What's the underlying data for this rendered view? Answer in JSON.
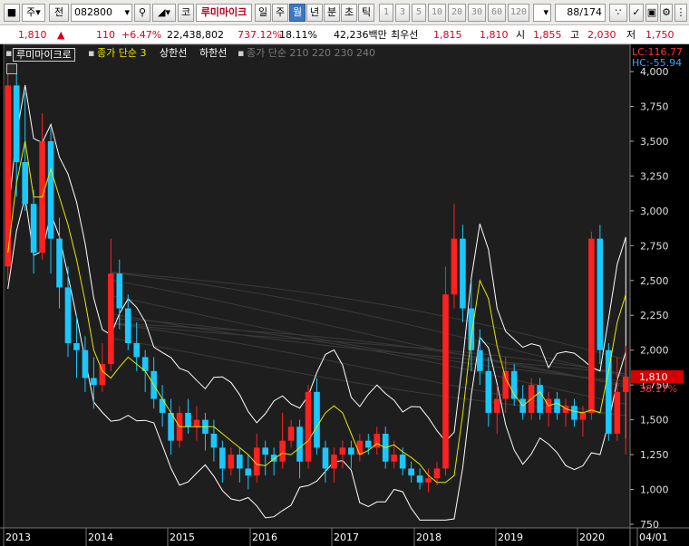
{
  "toolbar": {
    "market": "주",
    "market_mode": "전",
    "code": "082800",
    "stock_name": "루미마이크",
    "period_tabs": [
      "일",
      "주",
      "월",
      "년",
      "분",
      "초",
      "틱"
    ],
    "active_period": "월",
    "interval_buttons": [
      "1",
      "3",
      "5",
      "10",
      "20",
      "30",
      "60",
      "120"
    ],
    "page": "88",
    "page_total": "/174"
  },
  "info": {
    "price": "1,810",
    "change_arrow": "▲",
    "change": "110",
    "change_pct": "+6.47%",
    "volume": "22,438,802",
    "volume_ratio": "737.12%",
    "turnover": "18.11%",
    "amount": "42,236백만",
    "quote_label": "최우선",
    "ask": "1,815",
    "bid": "1,810",
    "open_label": "시",
    "open": "1,855",
    "high_label": "고",
    "high": "2,030",
    "low_label": "저",
    "low": "1,750"
  },
  "legend": {
    "name": "루미마이크로",
    "ma": "종가 단순 3",
    "upper": "상한선",
    "lower": "하한선",
    "long_ma": "종가 단순 210 220 230 240"
  },
  "readout": {
    "lc": "LC:116.77",
    "hc": "HC:-55.94",
    "last_price": "1,810",
    "last_pct": "38.17%"
  },
  "colors": {
    "up": "#ff2020",
    "down": "#19c8ff",
    "ma3": "#e8e800",
    "band": "#ffffff",
    "long_ma": "#3a3a3a",
    "price_tag": "#d60000"
  },
  "chart_data": {
    "type": "candlestick",
    "title": "루미마이크로",
    "ylim": [
      750,
      4000
    ],
    "y_ticks": [
      750,
      1000,
      1250,
      1500,
      1750,
      2000,
      2250,
      2500,
      2750,
      3000,
      3250,
      3500,
      3750,
      4000
    ],
    "y_tick_labels": [
      "750",
      "1,000",
      "1,250",
      "1,500",
      "1,750",
      "2,000",
      "2,250",
      "2,500",
      "2,750",
      "3,000",
      "3,250",
      "3,500",
      "3,750",
      "4,000"
    ],
    "x_labels": [
      "2013",
      "2014",
      "2015",
      "2016",
      "2017",
      "2018",
      "2019",
      "2020",
      "04/01"
    ],
    "candles": [
      [
        2600,
        4000,
        2500,
        3900
      ],
      [
        3900,
        4050,
        3100,
        3350
      ],
      [
        3350,
        3850,
        3000,
        3050
      ],
      [
        3050,
        3150,
        2550,
        2700
      ],
      [
        2700,
        3700,
        2650,
        3500
      ],
      [
        3500,
        3600,
        2550,
        2800
      ],
      [
        2800,
        2950,
        2300,
        2450
      ],
      [
        2450,
        2600,
        1950,
        2050
      ],
      [
        2050,
        2250,
        1800,
        2000
      ],
      [
        2000,
        2100,
        1700,
        1800
      ],
      [
        1800,
        1950,
        1580,
        1750
      ],
      [
        1750,
        2050,
        1700,
        1900
      ],
      [
        1900,
        2800,
        1850,
        2550
      ],
      [
        2550,
        2650,
        2150,
        2300
      ],
      [
        2300,
        2400,
        2000,
        2050
      ],
      [
        2050,
        2200,
        1850,
        1950
      ],
      [
        1950,
        2000,
        1700,
        1850
      ],
      [
        1850,
        1950,
        1580,
        1650
      ],
      [
        1650,
        1750,
        1450,
        1550
      ],
      [
        1550,
        1650,
        1250,
        1350
      ],
      [
        1350,
        1600,
        1300,
        1550
      ],
      [
        1550,
        1650,
        1400,
        1450
      ],
      [
        1450,
        1600,
        1350,
        1500
      ],
      [
        1500,
        1550,
        1280,
        1400
      ],
      [
        1400,
        1500,
        1200,
        1300
      ],
      [
        1300,
        1350,
        1050,
        1150
      ],
      [
        1150,
        1300,
        1100,
        1250
      ],
      [
        1250,
        1300,
        1050,
        1150
      ],
      [
        1150,
        1250,
        1000,
        1100
      ],
      [
        1100,
        1400,
        1050,
        1300
      ],
      [
        1300,
        1350,
        1100,
        1250
      ],
      [
        1250,
        1300,
        1100,
        1200
      ],
      [
        1200,
        1550,
        1150,
        1350
      ],
      [
        1350,
        1500,
        1300,
        1450
      ],
      [
        1450,
        1500,
        1080,
        1200
      ],
      [
        1200,
        1750,
        1150,
        1700
      ],
      [
        1700,
        1800,
        1250,
        1300
      ],
      [
        1300,
        1350,
        1050,
        1150
      ],
      [
        1150,
        1300,
        1050,
        1250
      ],
      [
        1250,
        1350,
        1150,
        1300
      ],
      [
        1300,
        1350,
        1150,
        1250
      ],
      [
        1250,
        1400,
        1200,
        1350
      ],
      [
        1350,
        1400,
        1250,
        1300
      ],
      [
        1300,
        1450,
        1250,
        1400
      ],
      [
        1400,
        1450,
        1150,
        1200
      ],
      [
        1200,
        1350,
        1150,
        1250
      ],
      [
        1250,
        1300,
        1100,
        1150
      ],
      [
        1150,
        1200,
        1050,
        1100
      ],
      [
        1100,
        1150,
        1000,
        1050
      ],
      [
        1050,
        1150,
        980,
        1080
      ],
      [
        1080,
        1200,
        1030,
        1150
      ],
      [
        1150,
        2600,
        1100,
        2400
      ],
      [
        2400,
        3050,
        2300,
        2800
      ],
      [
        2800,
        2900,
        2200,
        2300
      ],
      [
        2300,
        2500,
        1850,
        2000
      ],
      [
        2000,
        2150,
        1750,
        1850
      ],
      [
        1850,
        1950,
        1450,
        1550
      ],
      [
        1550,
        1750,
        1400,
        1650
      ],
      [
        1650,
        1950,
        1550,
        1850
      ],
      [
        1850,
        1900,
        1600,
        1650
      ],
      [
        1650,
        1750,
        1500,
        1550
      ],
      [
        1550,
        1800,
        1500,
        1750
      ],
      [
        1750,
        1800,
        1500,
        1550
      ],
      [
        1550,
        1700,
        1450,
        1650
      ],
      [
        1650,
        1700,
        1500,
        1550
      ],
      [
        1550,
        1650,
        1450,
        1600
      ],
      [
        1600,
        1650,
        1450,
        1500
      ],
      [
        1500,
        1600,
        1380,
        1550
      ],
      [
        1550,
        2850,
        1500,
        2800
      ],
      [
        2800,
        2900,
        1900,
        2000
      ],
      [
        2000,
        2050,
        1350,
        1400
      ],
      [
        1400,
        1950,
        1350,
        1700
      ],
      [
        1700,
        2030,
        1250,
        1810
      ]
    ],
    "series": [
      {
        "name": "종가 단순 3",
        "values": [
          2700,
          3200,
          3500,
          3100,
          3100,
          3300,
          3100,
          2900,
          2650,
          2350,
          2000,
          1850,
          1800,
          1880,
          1950,
          1900,
          1850,
          1750,
          1650,
          1550,
          1450,
          1450,
          1450,
          1450,
          1450,
          1400,
          1350,
          1300,
          1250,
          1180,
          1170,
          1220,
          1260,
          1250,
          1300,
          1350,
          1450,
          1550,
          1600,
          1550,
          1400,
          1250,
          1280,
          1330,
          1300,
          1320,
          1270,
          1230,
          1180,
          1100,
          1050,
          1050,
          1100,
          1540,
          2100,
          2500,
          2370,
          2030,
          1800,
          1680,
          1600,
          1650,
          1700,
          1600,
          1620,
          1580,
          1560,
          1550,
          1570,
          1550,
          1850,
          2200,
          2400,
          1950,
          1650
        ]
      }
    ]
  }
}
